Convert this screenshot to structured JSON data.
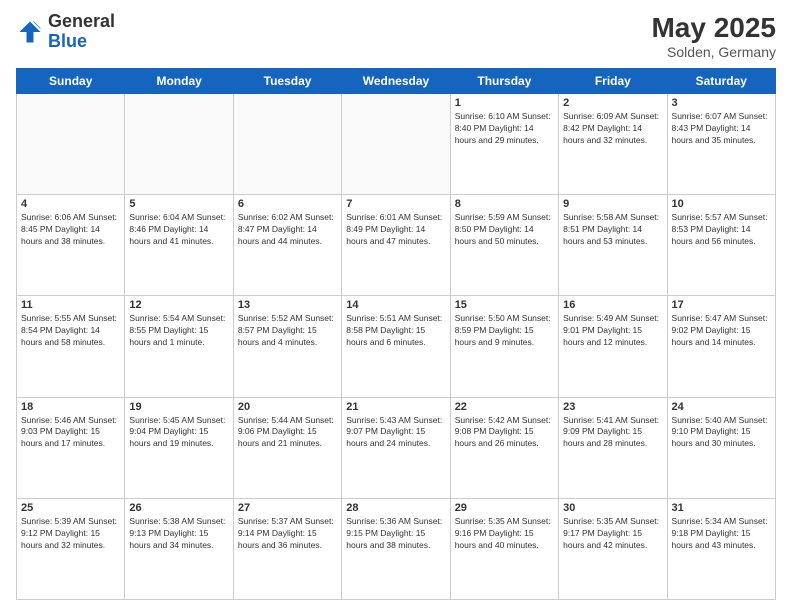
{
  "header": {
    "logo_general": "General",
    "logo_blue": "Blue",
    "month_year": "May 2025",
    "location": "Solden, Germany"
  },
  "weekdays": [
    "Sunday",
    "Monday",
    "Tuesday",
    "Wednesday",
    "Thursday",
    "Friday",
    "Saturday"
  ],
  "weeks": [
    [
      {
        "day": "",
        "info": ""
      },
      {
        "day": "",
        "info": ""
      },
      {
        "day": "",
        "info": ""
      },
      {
        "day": "",
        "info": ""
      },
      {
        "day": "1",
        "info": "Sunrise: 6:10 AM\nSunset: 8:40 PM\nDaylight: 14 hours\nand 29 minutes."
      },
      {
        "day": "2",
        "info": "Sunrise: 6:09 AM\nSunset: 8:42 PM\nDaylight: 14 hours\nand 32 minutes."
      },
      {
        "day": "3",
        "info": "Sunrise: 6:07 AM\nSunset: 8:43 PM\nDaylight: 14 hours\nand 35 minutes."
      }
    ],
    [
      {
        "day": "4",
        "info": "Sunrise: 6:06 AM\nSunset: 8:45 PM\nDaylight: 14 hours\nand 38 minutes."
      },
      {
        "day": "5",
        "info": "Sunrise: 6:04 AM\nSunset: 8:46 PM\nDaylight: 14 hours\nand 41 minutes."
      },
      {
        "day": "6",
        "info": "Sunrise: 6:02 AM\nSunset: 8:47 PM\nDaylight: 14 hours\nand 44 minutes."
      },
      {
        "day": "7",
        "info": "Sunrise: 6:01 AM\nSunset: 8:49 PM\nDaylight: 14 hours\nand 47 minutes."
      },
      {
        "day": "8",
        "info": "Sunrise: 5:59 AM\nSunset: 8:50 PM\nDaylight: 14 hours\nand 50 minutes."
      },
      {
        "day": "9",
        "info": "Sunrise: 5:58 AM\nSunset: 8:51 PM\nDaylight: 14 hours\nand 53 minutes."
      },
      {
        "day": "10",
        "info": "Sunrise: 5:57 AM\nSunset: 8:53 PM\nDaylight: 14 hours\nand 56 minutes."
      }
    ],
    [
      {
        "day": "11",
        "info": "Sunrise: 5:55 AM\nSunset: 8:54 PM\nDaylight: 14 hours\nand 58 minutes."
      },
      {
        "day": "12",
        "info": "Sunrise: 5:54 AM\nSunset: 8:55 PM\nDaylight: 15 hours\nand 1 minute."
      },
      {
        "day": "13",
        "info": "Sunrise: 5:52 AM\nSunset: 8:57 PM\nDaylight: 15 hours\nand 4 minutes."
      },
      {
        "day": "14",
        "info": "Sunrise: 5:51 AM\nSunset: 8:58 PM\nDaylight: 15 hours\nand 6 minutes."
      },
      {
        "day": "15",
        "info": "Sunrise: 5:50 AM\nSunset: 8:59 PM\nDaylight: 15 hours\nand 9 minutes."
      },
      {
        "day": "16",
        "info": "Sunrise: 5:49 AM\nSunset: 9:01 PM\nDaylight: 15 hours\nand 12 minutes."
      },
      {
        "day": "17",
        "info": "Sunrise: 5:47 AM\nSunset: 9:02 PM\nDaylight: 15 hours\nand 14 minutes."
      }
    ],
    [
      {
        "day": "18",
        "info": "Sunrise: 5:46 AM\nSunset: 9:03 PM\nDaylight: 15 hours\nand 17 minutes."
      },
      {
        "day": "19",
        "info": "Sunrise: 5:45 AM\nSunset: 9:04 PM\nDaylight: 15 hours\nand 19 minutes."
      },
      {
        "day": "20",
        "info": "Sunrise: 5:44 AM\nSunset: 9:06 PM\nDaylight: 15 hours\nand 21 minutes."
      },
      {
        "day": "21",
        "info": "Sunrise: 5:43 AM\nSunset: 9:07 PM\nDaylight: 15 hours\nand 24 minutes."
      },
      {
        "day": "22",
        "info": "Sunrise: 5:42 AM\nSunset: 9:08 PM\nDaylight: 15 hours\nand 26 minutes."
      },
      {
        "day": "23",
        "info": "Sunrise: 5:41 AM\nSunset: 9:09 PM\nDaylight: 15 hours\nand 28 minutes."
      },
      {
        "day": "24",
        "info": "Sunrise: 5:40 AM\nSunset: 9:10 PM\nDaylight: 15 hours\nand 30 minutes."
      }
    ],
    [
      {
        "day": "25",
        "info": "Sunrise: 5:39 AM\nSunset: 9:12 PM\nDaylight: 15 hours\nand 32 minutes."
      },
      {
        "day": "26",
        "info": "Sunrise: 5:38 AM\nSunset: 9:13 PM\nDaylight: 15 hours\nand 34 minutes."
      },
      {
        "day": "27",
        "info": "Sunrise: 5:37 AM\nSunset: 9:14 PM\nDaylight: 15 hours\nand 36 minutes."
      },
      {
        "day": "28",
        "info": "Sunrise: 5:36 AM\nSunset: 9:15 PM\nDaylight: 15 hours\nand 38 minutes."
      },
      {
        "day": "29",
        "info": "Sunrise: 5:35 AM\nSunset: 9:16 PM\nDaylight: 15 hours\nand 40 minutes."
      },
      {
        "day": "30",
        "info": "Sunrise: 5:35 AM\nSunset: 9:17 PM\nDaylight: 15 hours\nand 42 minutes."
      },
      {
        "day": "31",
        "info": "Sunrise: 5:34 AM\nSunset: 9:18 PM\nDaylight: 15 hours\nand 43 minutes."
      }
    ]
  ]
}
